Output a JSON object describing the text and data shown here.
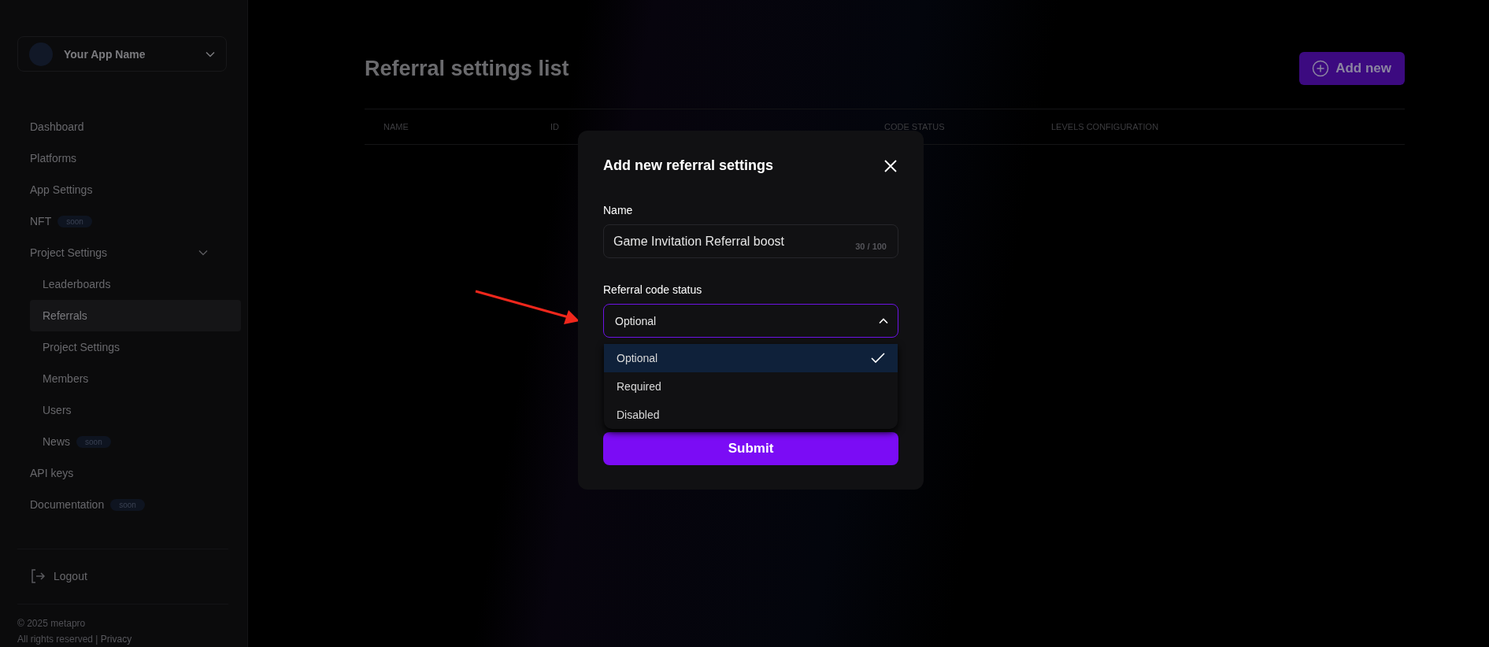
{
  "app_switcher": {
    "name": "Your App Name"
  },
  "nav": [
    {
      "label": "Dashboard",
      "selected": false
    },
    {
      "label": "Platforms",
      "selected": false
    },
    {
      "label": "App Settings",
      "selected": false
    },
    {
      "label": "NFT",
      "selected": false,
      "badge": "soon"
    },
    {
      "label": "Project Settings",
      "selected": false,
      "expanded": true,
      "children": [
        {
          "label": "Leaderboards",
          "selected": false
        },
        {
          "label": "Referrals",
          "selected": true
        },
        {
          "label": "Project Settings",
          "selected": false
        },
        {
          "label": "Members",
          "selected": false
        },
        {
          "label": "Users",
          "selected": false
        },
        {
          "label": "News",
          "selected": false,
          "badge": "soon"
        }
      ]
    },
    {
      "label": "API keys",
      "selected": false
    },
    {
      "label": "Documentation",
      "selected": false,
      "badge": "soon"
    }
  ],
  "logout": "Logout",
  "footer": {
    "copyright": "© 2025 metapro",
    "rights": "All rights reserved |",
    "privacy": "Privacy"
  },
  "page": {
    "title": "Referral settings list",
    "add_button": "Add new",
    "columns": [
      "NAME",
      "ID",
      "CODE STATUS",
      "LEVELS CONFIGURATION"
    ]
  },
  "modal": {
    "title": "Add new referral settings",
    "name_label": "Name",
    "name_value": "Game Invitation Referral boost",
    "name_counter": "30 / 100",
    "status_label": "Referral code status",
    "status_value": "Optional",
    "expanded": true,
    "options": [
      {
        "label": "Optional",
        "selected": true
      },
      {
        "label": "Required",
        "selected": false
      },
      {
        "label": "Disabled",
        "selected": false
      }
    ],
    "submit": "Submit"
  }
}
